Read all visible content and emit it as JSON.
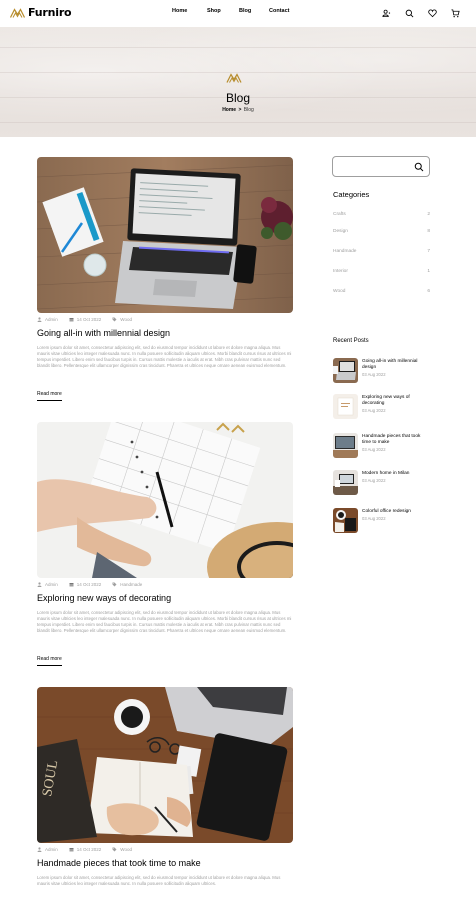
{
  "brand": {
    "name": "Furniro"
  },
  "nav": {
    "items": [
      "Home",
      "Shop",
      "Blog",
      "Contact"
    ]
  },
  "header_icons": [
    "user-icon",
    "search-icon",
    "heart-icon",
    "cart-icon"
  ],
  "hero": {
    "title": "Blog",
    "breadcrumb": {
      "home": "Home",
      "separator": ">",
      "current": "Blog"
    }
  },
  "posts": [
    {
      "author": "Admin",
      "date": "14 Oct 2022",
      "tag": "Wood",
      "title": "Going all-in with millennial design",
      "body": "Lorem ipsum dolor sit amet, consectetur adipiscing elit, sed do eiusmod tempor incididunt ut labore et dolore magna aliqua. Mus mauris vitae ultricies leo integer malesuada nunc. In nulla posuere sollicitudin aliquam ultrices. Morbi blandit cursus risus at ultrices mi tempus imperdiet. Libero enim sed faucibus turpis in. Cursus mattis molestie a iaculis at erat. Nibh cras pulvinar mattis nunc sed blandit libero. Pellentesque elit ullamcorper dignissim cras tincidunt. Pharetra et ultrices neque ornare aenean euismod elementum.",
      "read_more": "Read more"
    },
    {
      "author": "Admin",
      "date": "14 Oct 2022",
      "tag": "Handmade",
      "title": "Exploring new ways of decorating",
      "body": "Lorem ipsum dolor sit amet, consectetur adipiscing elit, sed do eiusmod tempor incididunt ut labore et dolore magna aliqua. Mus mauris vitae ultricies leo integer malesuada nunc. In nulla posuere sollicitudin aliquam ultrices. Morbi blandit cursus risus at ultrices mi tempus imperdiet. Libero enim sed faucibus turpis in. Cursus mattis molestie a iaculis at erat. Nibh cras pulvinar mattis nunc sed blandit libero. Pellentesque elit ullamcorper dignissim cras tincidunt. Pharetra et ultrices neque ornare aenean euismod elementum.",
      "read_more": "Read more"
    },
    {
      "author": "Admin",
      "date": "14 Oct 2022",
      "tag": "Wood",
      "title": "Handmade pieces that took time to make",
      "body": "Lorem ipsum dolor sit amet, consectetur adipiscing elit, sed do eiusmod tempor incididunt ut labore et dolore magna aliqua. Mus mauris vitae ultricies leo integer malesuada nunc. In nulla posuere sollicitudin aliquam ultrices.",
      "read_more": "Read more"
    }
  ],
  "sidebar": {
    "search": {
      "value": "",
      "placeholder": ""
    },
    "categories_title": "Categories",
    "categories": [
      {
        "name": "Crafts",
        "count": "2"
      },
      {
        "name": "Design",
        "count": "8"
      },
      {
        "name": "Handmade",
        "count": "7"
      },
      {
        "name": "Interior",
        "count": "1"
      },
      {
        "name": "Wood",
        "count": "6"
      }
    ],
    "recent_title": "Recent Posts",
    "recent_posts": [
      {
        "title": "Going all-in with millennial design",
        "date": "03 Aug 2022"
      },
      {
        "title": "Exploring new ways of decorating",
        "date": "03 Aug 2022"
      },
      {
        "title": "Handmade pieces that took time to make",
        "date": "03 Aug 2022"
      },
      {
        "title": "Modern home in Milan",
        "date": "03 Aug 2022"
      },
      {
        "title": "Colorful office redesign",
        "date": "03 Aug 2022"
      }
    ]
  },
  "colors": {
    "accent": "#b88e2f",
    "muted": "#9f9f9f"
  }
}
